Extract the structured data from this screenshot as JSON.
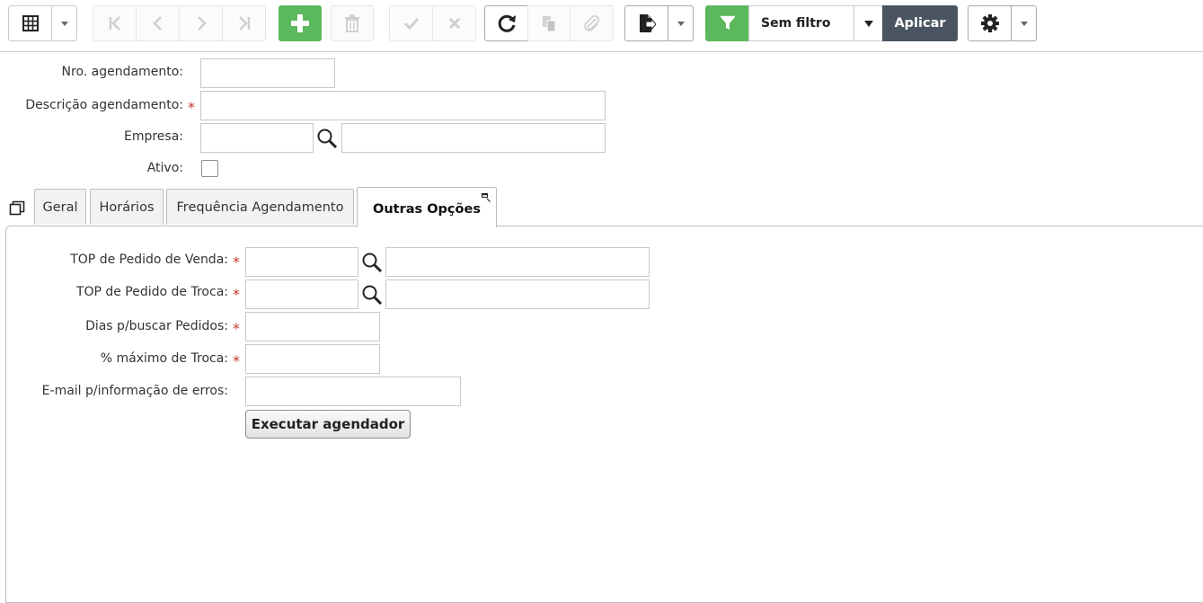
{
  "toolbar": {
    "filter_value": "Sem filtro",
    "apply_label": "Aplicar",
    "colors": {
      "green": "#5cb85c",
      "dark": "#4a5461"
    },
    "icons": [
      "grid-icon",
      "caret-down-icon",
      "first-record-icon",
      "previous-record-icon",
      "next-record-icon",
      "last-record-icon",
      "add-icon",
      "delete-icon",
      "confirm-icon",
      "cancel-icon",
      "refresh-icon",
      "duplicate-icon",
      "attachment-icon",
      "export-icon",
      "funnel-icon",
      "gear-icon"
    ]
  },
  "form": {
    "nro_label": "Nro. agendamento:",
    "nro_value": "",
    "descricao_label": "Descrição agendamento:",
    "descricao_value": "",
    "empresa_label": "Empresa:",
    "empresa_code": "",
    "empresa_name": "",
    "ativo_label": "Ativo:",
    "ativo_checked": false,
    "required_marker": "*"
  },
  "tabs": [
    {
      "label": "Geral"
    },
    {
      "label": "Horários"
    },
    {
      "label": "Frequência Agendamento"
    },
    {
      "label": "Outras Opções",
      "active": true
    }
  ],
  "outras_opcoes": {
    "top_venda_label": "TOP de Pedido de Venda:",
    "top_venda_code": "",
    "top_venda_desc": "",
    "top_troca_label": "TOP de Pedido de Troca:",
    "top_troca_code": "",
    "top_troca_desc": "",
    "dias_label": "Dias p/buscar Pedidos:",
    "dias_value": "",
    "maximo_troca_label": "% máximo de Troca:",
    "maximo_troca_value": "",
    "email_label": "E-mail p/informação de erros:",
    "email_value": "",
    "executar_label": "Executar agendador"
  }
}
